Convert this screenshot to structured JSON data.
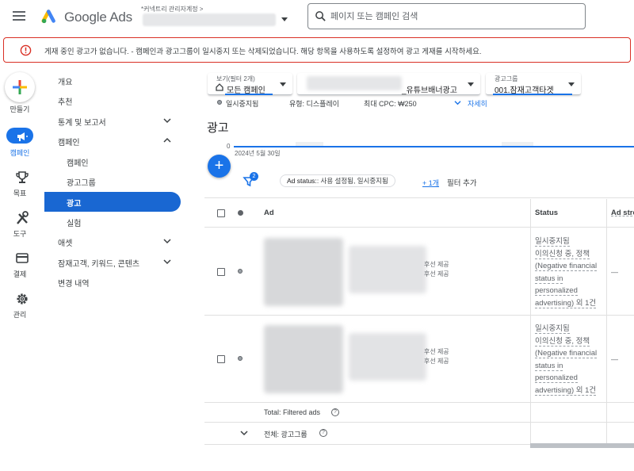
{
  "header": {
    "logo_text": "Google Ads",
    "account_label": "*커넥트리 관리자계정 >",
    "search_placeholder": "페이지 또는 캠페인 검색"
  },
  "alert": {
    "text": "게재 중인 광고가 없습니다. - 캠페인과 광고그룹이 일시중지 또는 삭제되었습니다. 해당 항목을 사용하도록 설정하여 광고 게재를 시작하세요."
  },
  "rail": {
    "create_label": "만들기",
    "items": [
      {
        "label": "캠페인",
        "icon": "megaphone-icon"
      },
      {
        "label": "목표",
        "icon": "trophy-icon"
      },
      {
        "label": "도구",
        "icon": "tools-icon"
      },
      {
        "label": "결제",
        "icon": "credit-card-icon"
      },
      {
        "label": "관리",
        "icon": "gear-icon"
      }
    ]
  },
  "sidenav": {
    "items": [
      {
        "label": "개요"
      },
      {
        "label": "추천"
      },
      {
        "label": "통계 및 보고서"
      },
      {
        "label": "캠페인"
      },
      {
        "label": "캠페인"
      },
      {
        "label": "광고그룹"
      },
      {
        "label": "광고"
      },
      {
        "label": "실험"
      },
      {
        "label": "애셋"
      },
      {
        "label": "잠재고객, 키워드, 콘텐츠"
      },
      {
        "label": "변경 내역"
      }
    ]
  },
  "selectors": {
    "view": {
      "caption": "보기(필터 2개)",
      "value": "모든 캠페인"
    },
    "campaign": {
      "value": "_유튜브배너광고"
    },
    "adgroup": {
      "caption": "광고그룹",
      "value": "001.잠재고객타겟"
    }
  },
  "meta": {
    "status": "일시중지됨",
    "type": "유형: 디스플레이",
    "cpc": "최대 CPC: ₩250",
    "details": "자세히"
  },
  "page_title": "광고",
  "chart": {
    "zero": "0",
    "date": "2024년 5월 30일"
  },
  "filters": {
    "badge": "2",
    "chip_key": "Ad status:",
    "chip_value": ": 사용 설정됨, 일시중지됨",
    "more": "+ 1개",
    "add": "필터 추가"
  },
  "table": {
    "headers": {
      "ad": "Ad",
      "status": "Status",
      "strength": "Ad stre"
    },
    "rows": [
      {
        "snippet1": "후선 제공",
        "snippet2": "후선 제공",
        "status_lines": [
          "일시중지됨",
          "이의신청 중, 정책",
          "(Negative financial",
          "status in",
          "personalized",
          "advertising) 외 1건"
        ],
        "strength": "—"
      },
      {
        "snippet1": "후선 제공",
        "snippet2": "후선 제공",
        "status_lines": [
          "일시중지됨",
          "이의신청 중, 정책",
          "(Negative financial",
          "status in",
          "personalized",
          "advertising) 외 1건"
        ],
        "strength": "—"
      }
    ],
    "total_filtered": "Total: Filtered ads",
    "total_adgroup": "전체: 광고그룹"
  },
  "colors": {
    "accent": "#1a73e8",
    "alert_border": "#d93025",
    "active_nav": "#1967d2"
  }
}
